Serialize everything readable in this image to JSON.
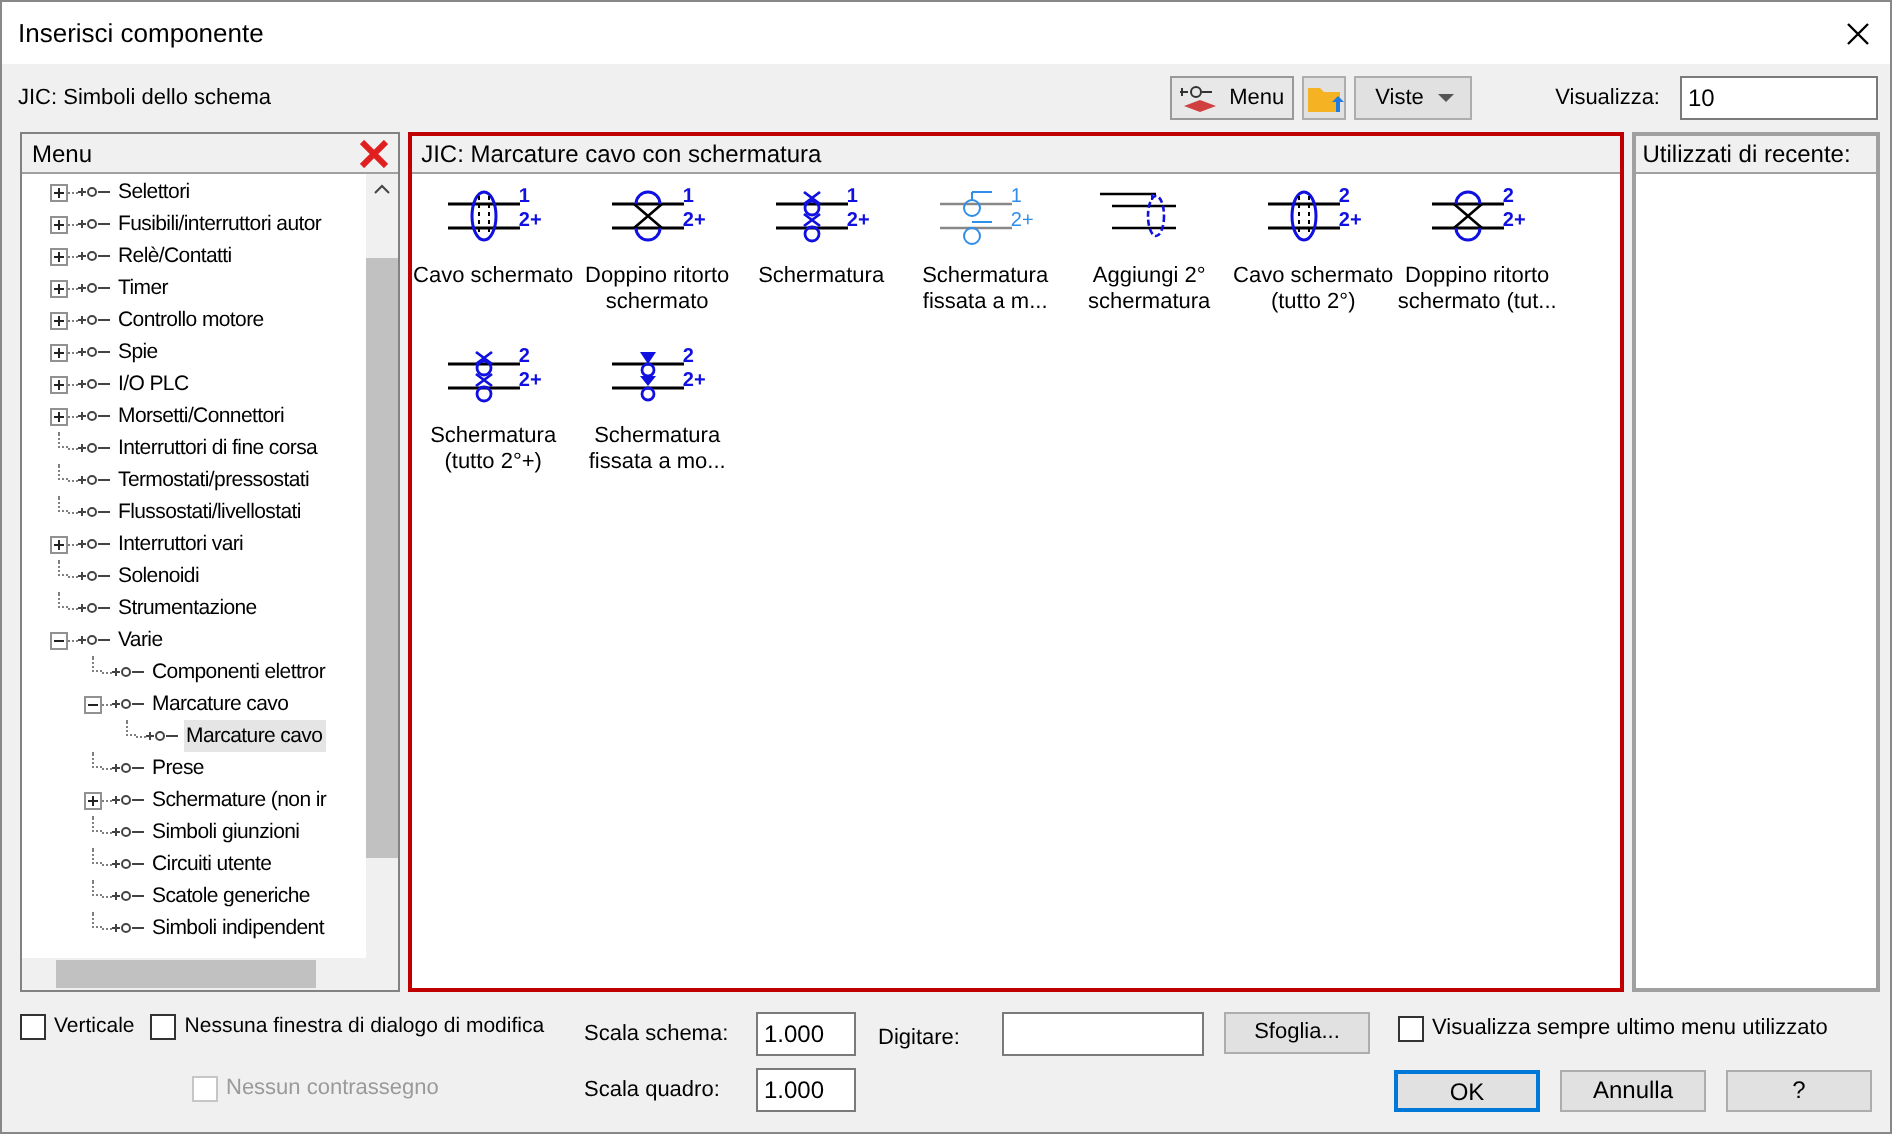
{
  "window": {
    "title": "Inserisci componente"
  },
  "toolbar": {
    "library": "JIC: Simboli dello schema",
    "menu_button": "Menu",
    "views_button": "Viste",
    "display_label": "Visualizza:",
    "display_value": "10"
  },
  "menu_panel": {
    "title": "Menu",
    "tree": [
      {
        "label": "Selettori",
        "kind": "folder",
        "expanded": false,
        "selected": false
      },
      {
        "label": "Fusibili/interruttori autor",
        "kind": "folder",
        "expanded": false,
        "selected": false
      },
      {
        "label": "Relè/Contatti",
        "kind": "folder",
        "expanded": false,
        "selected": false
      },
      {
        "label": "Timer",
        "kind": "folder",
        "expanded": false,
        "selected": false
      },
      {
        "label": "Controllo motore",
        "kind": "folder",
        "expanded": false,
        "selected": false
      },
      {
        "label": "Spie",
        "kind": "folder",
        "expanded": false,
        "selected": false
      },
      {
        "label": "I/O PLC",
        "kind": "folder",
        "expanded": false,
        "selected": false
      },
      {
        "label": "Morsetti/Connettori",
        "kind": "folder",
        "expanded": false,
        "selected": false
      },
      {
        "label": "Interruttori di fine corsa",
        "kind": "leaf",
        "selected": false
      },
      {
        "label": "Termostati/pressostati",
        "kind": "leaf",
        "selected": false
      },
      {
        "label": "Flussostati/livellostati",
        "kind": "leaf",
        "selected": false
      },
      {
        "label": "Interruttori vari",
        "kind": "folder",
        "expanded": false,
        "selected": false
      },
      {
        "label": "Solenoidi",
        "kind": "leaf",
        "selected": false
      },
      {
        "label": "Strumentazione",
        "kind": "leaf",
        "selected": false
      },
      {
        "label": "Varie",
        "kind": "folder",
        "expanded": true,
        "selected": false,
        "children": [
          {
            "label": "Componenti elettror",
            "kind": "leaf",
            "selected": false
          },
          {
            "label": "Marcature cavo",
            "kind": "folder",
            "expanded": true,
            "selected": false,
            "children": [
              {
                "label": "Marcature cavo",
                "kind": "leaf",
                "selected": true
              }
            ]
          },
          {
            "label": "Prese",
            "kind": "leaf",
            "selected": false
          },
          {
            "label": "Schermature (non ir",
            "kind": "folder",
            "expanded": false,
            "selected": false
          },
          {
            "label": "Simboli giunzioni",
            "kind": "leaf",
            "selected": false
          },
          {
            "label": "Circuiti utente",
            "kind": "leaf",
            "selected": false
          },
          {
            "label": "Scatole generiche",
            "kind": "leaf",
            "selected": false
          },
          {
            "label": "Simboli indipendent",
            "kind": "leaf",
            "selected": false
          }
        ]
      }
    ]
  },
  "symbols_panel": {
    "title": "JIC: Marcature cavo con schermatura",
    "items": [
      {
        "kind": "shield",
        "top_mark": "1",
        "bottom_mark": "2+",
        "lines": [
          "Cavo schermato"
        ]
      },
      {
        "kind": "twisted",
        "top_mark": "1",
        "bottom_mark": "2+",
        "lines": [
          "Doppino ritorto",
          "schermato"
        ]
      },
      {
        "kind": "terminal",
        "top_mark": "1",
        "bottom_mark": "2+",
        "lines": [
          "Schermatura"
        ]
      },
      {
        "kind": "fixed",
        "top_mark": "1",
        "bottom_mark": "2+",
        "lines": [
          "Schermatura",
          "fissata a m..."
        ]
      },
      {
        "kind": "add",
        "lines": [
          "Aggiungi 2°",
          "schermatura"
        ]
      },
      {
        "kind": "shield",
        "top_mark": "2",
        "bottom_mark": "2+",
        "lines": [
          "Cavo schermato",
          "(tutto 2°)"
        ]
      },
      {
        "kind": "twisted",
        "top_mark": "2",
        "bottom_mark": "2+",
        "lines": [
          "Doppino ritorto",
          "schermato (tut..."
        ]
      },
      {
        "kind": "terminal",
        "top_mark": "2",
        "bottom_mark": "2+",
        "lines": [
          "Schermatura",
          "(tutto 2°+)"
        ]
      },
      {
        "kind": "arrow",
        "top_mark": "2",
        "bottom_mark": "2+",
        "lines": [
          "Schermatura",
          "fissata a mo..."
        ]
      }
    ]
  },
  "recent_panel": {
    "title": "Utilizzati di recente:"
  },
  "options": [
    {
      "label": "Verticale",
      "checked": false,
      "disabled": false
    },
    {
      "label": "Nessuna finestra di dialogo di modifica",
      "checked": false,
      "disabled": false
    },
    {
      "label": "Nessun contrassegno",
      "checked": false,
      "disabled": true
    }
  ],
  "scale": {
    "schema_label": "Scala schema:",
    "schema_value": "1.000",
    "panel_label": "Scala quadro:",
    "panel_value": "1.000"
  },
  "type_field": {
    "label": "Digitare:"
  },
  "browse_button": "Sfoglia...",
  "always_show": {
    "label": "Visualizza sempre ultimo menu utilizzato",
    "checked": false
  },
  "buttons": [
    {
      "label": "OK",
      "default": true
    },
    {
      "label": "Annulla",
      "default": false
    },
    {
      "label": "?",
      "default": false
    }
  ]
}
